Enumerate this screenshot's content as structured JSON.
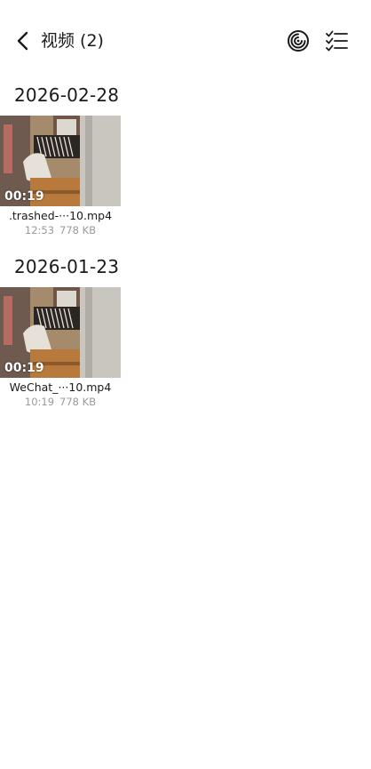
{
  "header": {
    "title": "视频 (2)",
    "back_icon": "chevron-left-icon",
    "storage_icon": "storage-swirl-icon",
    "select_icon": "checklist-icon"
  },
  "sections": [
    {
      "date": "2026-02-28",
      "items": [
        {
          "duration": "00:19",
          "name": ".trashed-···10.mp4",
          "time": "12:53",
          "size": "778 KB"
        }
      ]
    },
    {
      "date": "2026-01-23",
      "items": [
        {
          "duration": "00:19",
          "name": "WeChat_···10.mp4",
          "time": "10:19",
          "size": "778 KB"
        }
      ]
    }
  ],
  "colors": {
    "text_primary": "#1a1a1a",
    "text_secondary": "#9a9a9a",
    "background": "#ffffff"
  }
}
